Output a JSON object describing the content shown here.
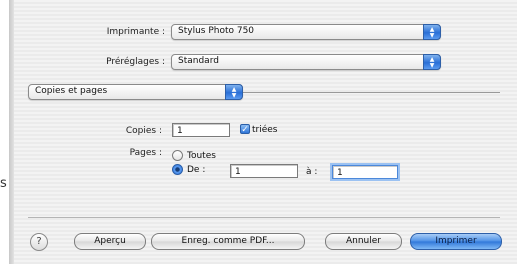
{
  "printer": {
    "label": "Imprimante :",
    "value": "Stylus Photo 750"
  },
  "presets": {
    "label": "Préréglages :",
    "value": "Standard"
  },
  "panel_select": {
    "value": "Copies et pages"
  },
  "copies": {
    "label": "Copies :",
    "value": "1",
    "collated_label": "triées",
    "collated_checked": true
  },
  "pages": {
    "label": "Pages :",
    "all_label": "Toutes",
    "from_label": "De :",
    "from_value": "1",
    "to_label": "à :",
    "to_value": "1",
    "selected": "range"
  },
  "buttons": {
    "help": "?",
    "preview": "Aperçu",
    "save_pdf": "Enreg. comme PDF...",
    "cancel": "Annuler",
    "print": "Imprimer"
  },
  "side_text": "s",
  "colors": {
    "accent": "#2f76d9",
    "background": "#f0f0f0"
  }
}
